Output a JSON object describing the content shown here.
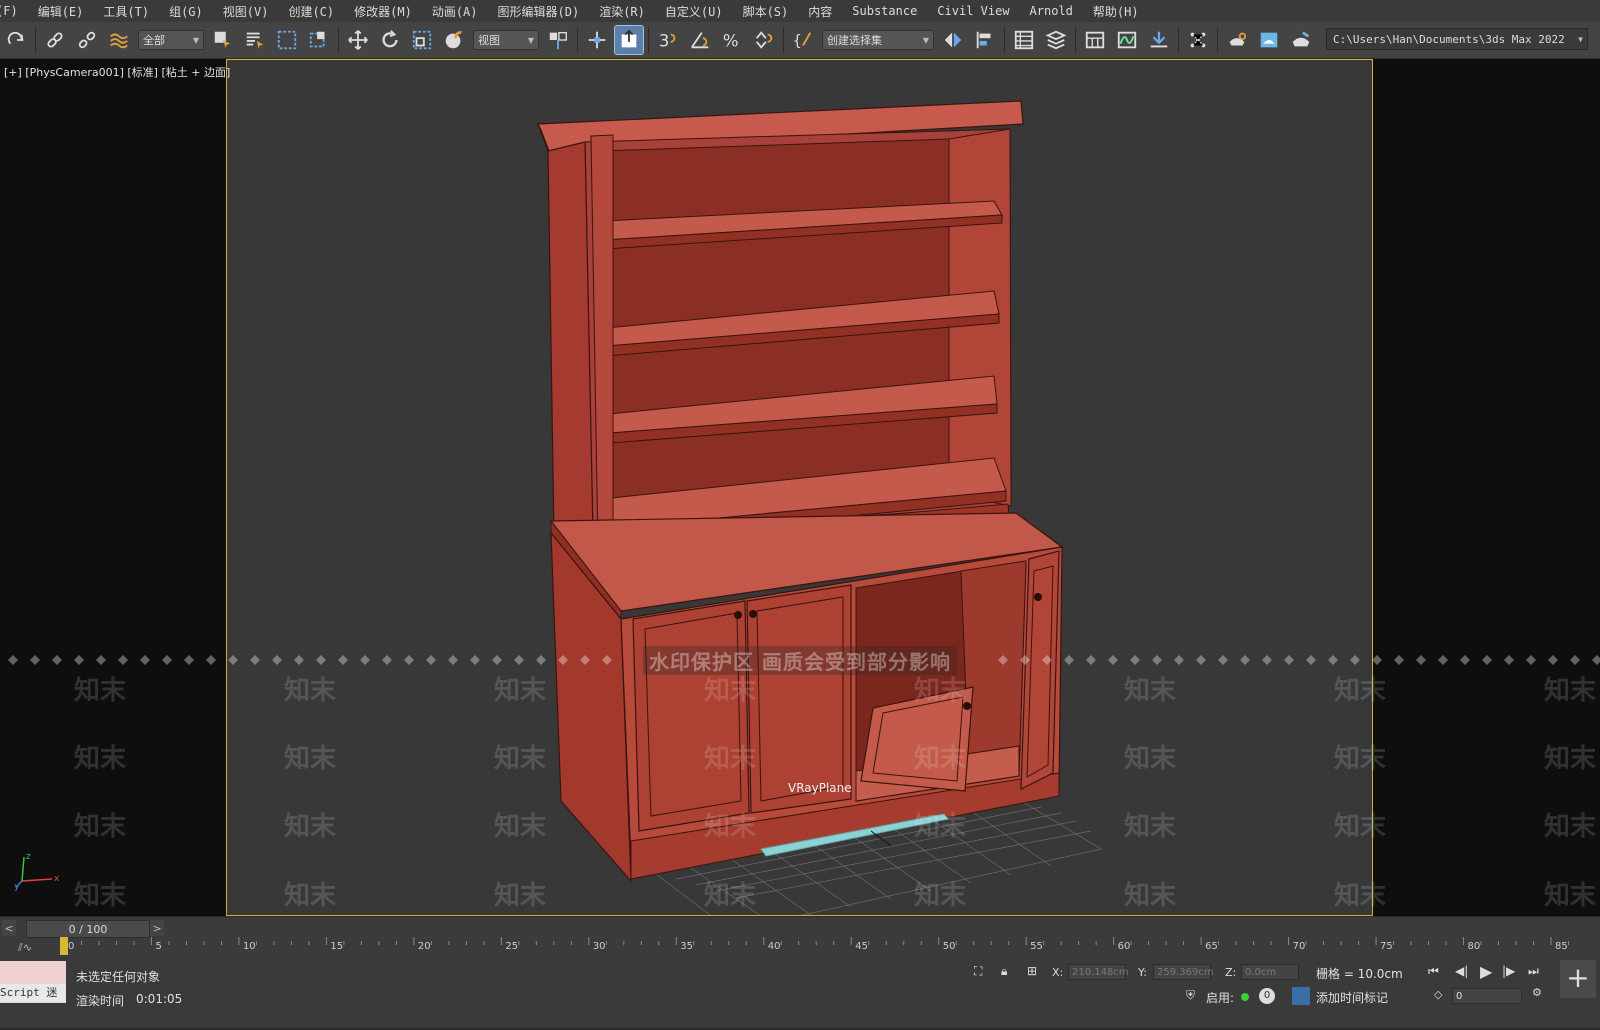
{
  "menu": [
    "(F)",
    "编辑(E)",
    "工具(T)",
    "组(G)",
    "视图(V)",
    "创建(C)",
    "修改器(M)",
    "动画(A)",
    "图形编辑器(D)",
    "渲染(R)",
    "自定义(U)",
    "脚本(S)",
    "内容",
    "Substance",
    "Civil View",
    "Arnold",
    "帮助(H)"
  ],
  "toolbar": {
    "filter_dropdown": "全部",
    "coord_dropdown": "视图",
    "selection_set": "创建选择集",
    "project_path": "C:\\Users\\Han\\Documents\\3ds Max 2022"
  },
  "viewport": {
    "label": "[+] [PhysCamera001] [标准] [粘土 + 边面]",
    "object_label": "VRayPlane",
    "watermark_banner": "水印保护区  画质会受到部分影响",
    "watermark_char": "知末"
  },
  "timeline": {
    "position": "0 / 100",
    "prev": "<",
    "next": ">",
    "ticks": [
      "0",
      "5",
      "10",
      "15",
      "20",
      "25",
      "30",
      "35",
      "40",
      "45",
      "50",
      "55",
      "60",
      "65",
      "70",
      "75",
      "80",
      "85"
    ]
  },
  "status": {
    "maxscript": "Script 迷",
    "selection": "未选定任何对象",
    "render_time_label": "渲染时间",
    "render_time": "0:01:05",
    "x_label": "X:",
    "x_value": "210.148cm",
    "y_label": "Y:",
    "y_value": "259.369cm",
    "z_label": "Z:",
    "z_value": "0.0cm",
    "grid": "栅格 = 10.0cm",
    "enable_label": "启用:",
    "add_time_tag": "添加时间标记",
    "frame_value": "0"
  },
  "colors": {
    "viewport_border": "#c8b43a",
    "cabinet": "#b5463a",
    "active_button": "#5b7fa8"
  }
}
